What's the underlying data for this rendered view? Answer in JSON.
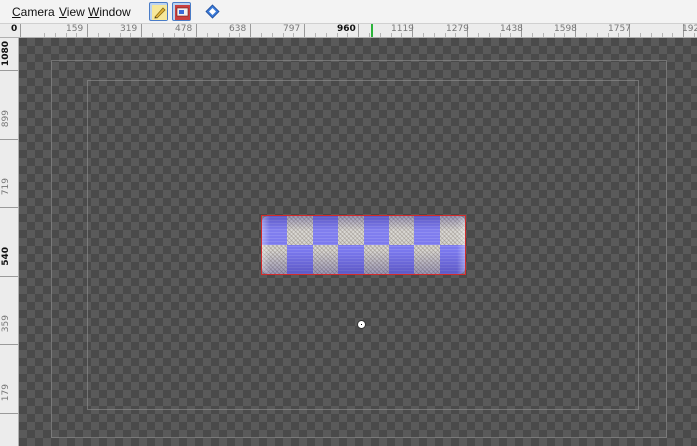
{
  "menu": {
    "items": [
      {
        "label": "Camera",
        "accel": "C",
        "rest": "amera"
      },
      {
        "label": "View",
        "accel": "V",
        "rest": "iew"
      },
      {
        "label": "Window",
        "accel": "W",
        "rest": "indow"
      }
    ]
  },
  "toolbar": {
    "buttons": [
      {
        "name": "transform-tool-button",
        "icon": "pencil-icon",
        "active": true
      },
      {
        "name": "render-region-button",
        "icon": "render-icon",
        "active": true
      },
      {
        "name": "navigate-button",
        "icon": "diamond-nav-icon",
        "active": false
      }
    ]
  },
  "hruler": {
    "labels": [
      "0",
      "159",
      "319",
      "478",
      "638",
      "797",
      "960",
      "1119",
      "1279",
      "1438",
      "1598",
      "1757",
      "192"
    ],
    "highlight": "960"
  },
  "vruler": {
    "labels": [
      "1080",
      "899",
      "719",
      "540",
      "359",
      "179"
    ],
    "strong": [
      "1080",
      "540"
    ]
  },
  "colors": {
    "selection": "#d22a2a",
    "checker_dark": "#4a4a4a",
    "checker_light": "#5a5a5a",
    "ruler_marker": "#2bb33a",
    "tile_blue": "#7a78ee",
    "tile_gray": "#d8d6d2"
  }
}
